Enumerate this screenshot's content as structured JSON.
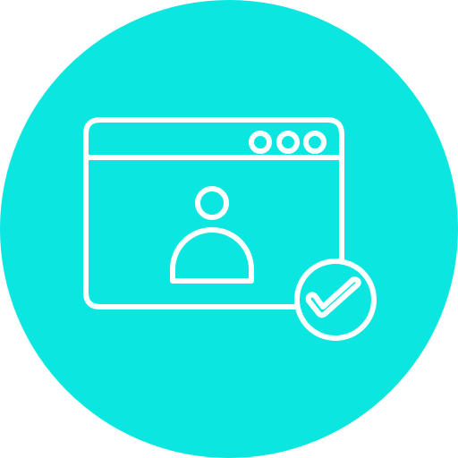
{
  "icon": {
    "name": "verified-user-profile-window-icon",
    "colors": {
      "background_circle": "#0BE6E0",
      "stroke": "#FFFFFF"
    },
    "window_control_dots": 3,
    "symbols": [
      "browser-window",
      "user-avatar",
      "check-badge"
    ]
  }
}
